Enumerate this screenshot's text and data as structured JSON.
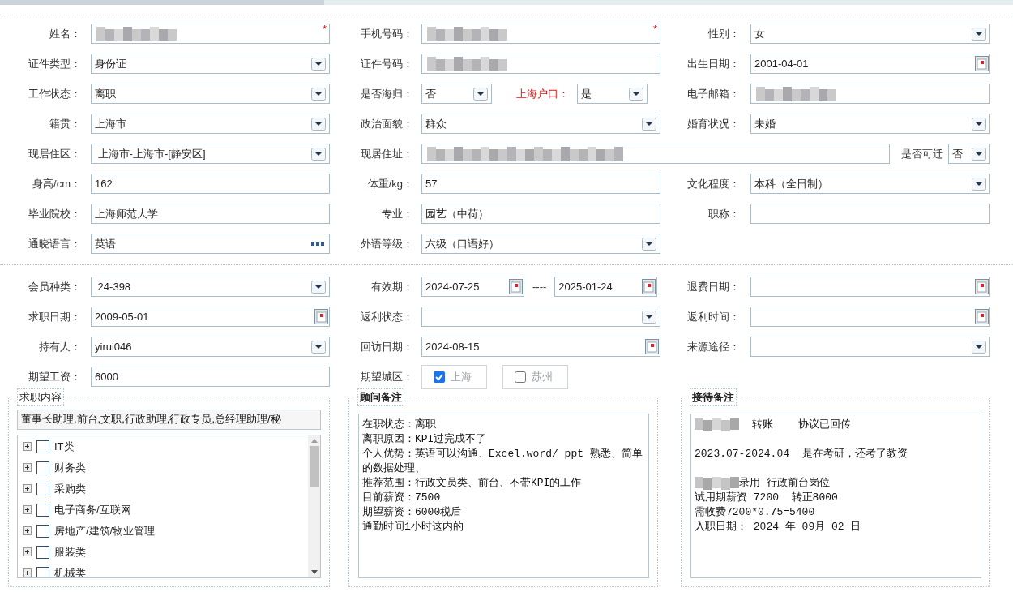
{
  "section1": {
    "rows": [
      {
        "kind": "standard",
        "cells": [
          {
            "fields": [
              {
                "label": "姓名：",
                "kind": "redacted",
                "required_mark": "*"
              }
            ]
          },
          {
            "fields": [
              {
                "label": "手机号码：",
                "kind": "redacted",
                "required_mark": "*"
              }
            ]
          },
          {
            "fields": [
              {
                "label": "性别：",
                "kind": "select",
                "value": "女"
              }
            ]
          }
        ]
      },
      {
        "kind": "standard",
        "cells": [
          {
            "fields": [
              {
                "label": "证件类型：",
                "kind": "select",
                "value": "身份证"
              }
            ]
          },
          {
            "fields": [
              {
                "label": "证件号码：",
                "kind": "redacted"
              }
            ]
          },
          {
            "fields": [
              {
                "label": "出生日期：",
                "kind": "date",
                "value": "2001-04-01"
              }
            ]
          }
        ]
      },
      {
        "kind": "standard",
        "cells": [
          {
            "fields": [
              {
                "label": "工作状态：",
                "kind": "select",
                "value": "离职"
              }
            ]
          },
          {
            "fields": [
              {
                "label": "是否海归：",
                "kind": "select",
                "value": "否"
              },
              {
                "label": "上海户口：",
                "kind": "select",
                "value": "是",
                "highlighted": true
              }
            ]
          },
          {
            "fields": [
              {
                "label": "电子邮箱：",
                "kind": "redacted"
              }
            ]
          }
        ]
      },
      {
        "kind": "standard",
        "cells": [
          {
            "fields": [
              {
                "label": "籍贯：",
                "kind": "select",
                "value": "上海市"
              }
            ]
          },
          {
            "fields": [
              {
                "label": "政治面貌：",
                "kind": "select",
                "value": "群众"
              }
            ]
          },
          {
            "fields": [
              {
                "label": "婚育状况：",
                "kind": "select",
                "value": "未婚"
              }
            ]
          }
        ]
      },
      {
        "kind": "address",
        "cells": [
          {
            "fields": [
              {
                "label": "现居住区：",
                "kind": "select",
                "value": " 上海市-上海市-[静安区]"
              }
            ]
          },
          {
            "fields": [
              {
                "label": "现居住址：",
                "kind": "redacted"
              },
              {
                "label": "是否可迁",
                "kind": "select",
                "value": "否"
              }
            ]
          }
        ]
      },
      {
        "kind": "standard",
        "cells": [
          {
            "fields": [
              {
                "label": "身高/cm：",
                "kind": "text",
                "value": "162"
              }
            ]
          },
          {
            "fields": [
              {
                "label": "体重/kg：",
                "kind": "text",
                "value": "57"
              }
            ]
          },
          {
            "fields": [
              {
                "label": "文化程度：",
                "kind": "select",
                "value": "本科（全日制）"
              }
            ]
          }
        ]
      },
      {
        "kind": "standard",
        "cells": [
          {
            "fields": [
              {
                "label": "毕业院校：",
                "kind": "text",
                "value": "上海师范大学"
              }
            ]
          },
          {
            "fields": [
              {
                "label": "专业：",
                "kind": "text",
                "value": "园艺（中荷）"
              }
            ]
          },
          {
            "fields": [
              {
                "label": "职称：",
                "kind": "text"
              }
            ]
          }
        ]
      },
      {
        "kind": "standard",
        "cells": [
          {
            "fields": [
              {
                "label": "通晓语言：",
                "kind": "lookup",
                "value": "英语"
              }
            ]
          },
          {
            "fields": [
              {
                "label": "外语等级：",
                "kind": "select",
                "value": "六级（口语好）"
              }
            ]
          }
        ]
      }
    ]
  },
  "section2": {
    "rows": [
      {
        "kind": "standard",
        "cells": [
          {
            "fields": [
              {
                "label": "会员种类：",
                "kind": "select",
                "value": " 24-398"
              }
            ]
          },
          {
            "fields": [
              {
                "label": "有效期：",
                "kind": "date-range",
                "values": [
                  "2024-07-25",
                  "2025-01-24"
                ],
                "separator": "----"
              }
            ]
          },
          {
            "fields": [
              {
                "label": "退费日期：",
                "kind": "date"
              }
            ]
          }
        ]
      },
      {
        "kind": "standard",
        "cells": [
          {
            "fields": [
              {
                "label": "求职日期：",
                "kind": "date",
                "value": "2009-05-01"
              }
            ]
          },
          {
            "fields": [
              {
                "label": "返利状态：",
                "kind": "select"
              }
            ]
          },
          {
            "fields": [
              {
                "label": "返利时间：",
                "kind": "date"
              }
            ]
          }
        ]
      },
      {
        "kind": "standard",
        "cells": [
          {
            "fields": [
              {
                "label": "持有人：",
                "kind": "select",
                "value": "yirui046"
              }
            ]
          },
          {
            "fields": [
              {
                "label": "回访日期：",
                "kind": "date",
                "value": "2024-08-15"
              }
            ]
          },
          {
            "fields": [
              {
                "label": "来源途径：",
                "kind": "select"
              }
            ]
          }
        ]
      },
      {
        "kind": "standard",
        "cells": [
          {
            "fields": [
              {
                "label": "期望工资：",
                "kind": "text",
                "value": "6000"
              }
            ]
          },
          {
            "fields": [
              {
                "label": "期望城区：",
                "kind": "options",
                "options": [
                  {
                    "label": "上海",
                    "checked": true,
                    "disabled": true
                  },
                  {
                    "label": "苏州",
                    "checked": false,
                    "disabled": true
                  }
                ]
              }
            ]
          }
        ]
      }
    ]
  },
  "panels": [
    {
      "legend": "求职内容",
      "bold": false,
      "kind": "tree",
      "summary": "董事长助理,前台,文职,行政助理,行政专员,总经理助理/秘",
      "items": [
        {
          "label": "IT类",
          "checked": false,
          "expanded": false
        },
        {
          "label": "财务类",
          "checked": false,
          "expanded": false
        },
        {
          "label": "采购类",
          "checked": false,
          "expanded": false
        },
        {
          "label": "电子商务/互联网",
          "checked": false,
          "expanded": false
        },
        {
          "label": "房地产/建筑/物业管理",
          "checked": false,
          "expanded": false
        },
        {
          "label": "服装类",
          "checked": false,
          "expanded": false
        },
        {
          "label": "机械类",
          "checked": false,
          "expanded": false
        }
      ]
    },
    {
      "legend": "顾问备注",
      "bold": true,
      "kind": "notes",
      "lines": [
        {
          "kind": "text",
          "text": "在职状态：离职"
        },
        {
          "kind": "text",
          "text": "离职原因：KPI过完成不了"
        },
        {
          "kind": "text",
          "text": "个人优势：英语可以沟通、Excel.word/ ppt 熟悉、简单的数据处理、"
        },
        {
          "kind": "text",
          "text": "推荐范围：行政文员类、前台、不带KPI的工作"
        },
        {
          "kind": "text",
          "text": "目前薪资：7500"
        },
        {
          "kind": "text",
          "text": "期望薪资：6000税后"
        },
        {
          "kind": "text",
          "text": "通勤时间1小时这内的"
        }
      ]
    },
    {
      "legend": "接待备注",
      "bold": true,
      "kind": "notes",
      "lines": [
        {
          "kind": "redacted-text",
          "text": "  转账    协议已回传"
        },
        {
          "kind": "blank"
        },
        {
          "kind": "text",
          "text": "2023.07-2024.04  是在考研，还考了教资"
        },
        {
          "kind": "blank"
        },
        {
          "kind": "redacted-text",
          "text": "录用 行政前台岗位"
        },
        {
          "kind": "text",
          "text": "试用期薪资 7200  转正8000"
        },
        {
          "kind": "text",
          "text": "需收费7200*0.75=5400"
        },
        {
          "kind": "text",
          "text": "入职日期： 2024 年 09月 02 日"
        }
      ]
    }
  ]
}
